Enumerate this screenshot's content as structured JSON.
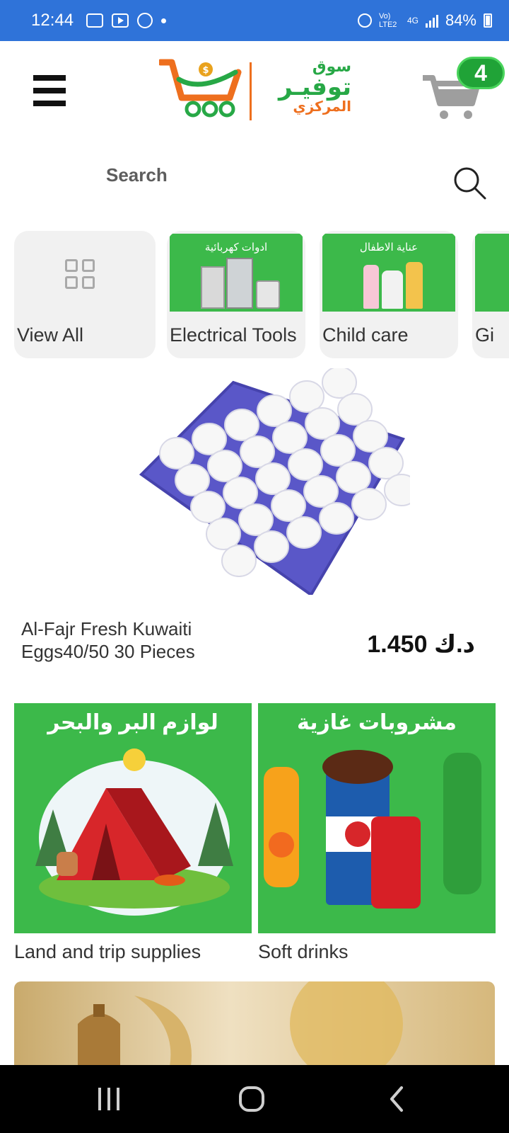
{
  "status_bar": {
    "time": "12:44",
    "network": "Vo) LTE2",
    "signal": "4G",
    "battery": "84%"
  },
  "header": {
    "logo_small": "سوق",
    "logo_main": "توفيـر",
    "logo_sub": "المركزي",
    "cart_count": "4"
  },
  "search": {
    "placeholder": "Search"
  },
  "categories": [
    {
      "label": "View All",
      "icon": "grid-icon"
    },
    {
      "label": "Electrical Tools",
      "image_text": "ادوات كهربائية"
    },
    {
      "label": "Child care",
      "image_text": "عناية الاطفال"
    },
    {
      "label": "Gi"
    }
  ],
  "featured_product": {
    "name": "Al-Fajr Fresh Kuwaiti Eggs40/50 30 Pieces",
    "price": "1.450",
    "currency": "د.ك"
  },
  "banners": [
    {
      "title_ar": "لوازم البر والبحر",
      "label": "Land and trip supplies"
    },
    {
      "title_ar": "مشروبات غازية",
      "label": "Soft drinks"
    }
  ],
  "colors": {
    "status_bar": "#2f73d9",
    "brand_green": "#27a846",
    "brand_orange": "#ee6f1e",
    "tile_green": "#3cb94a"
  }
}
